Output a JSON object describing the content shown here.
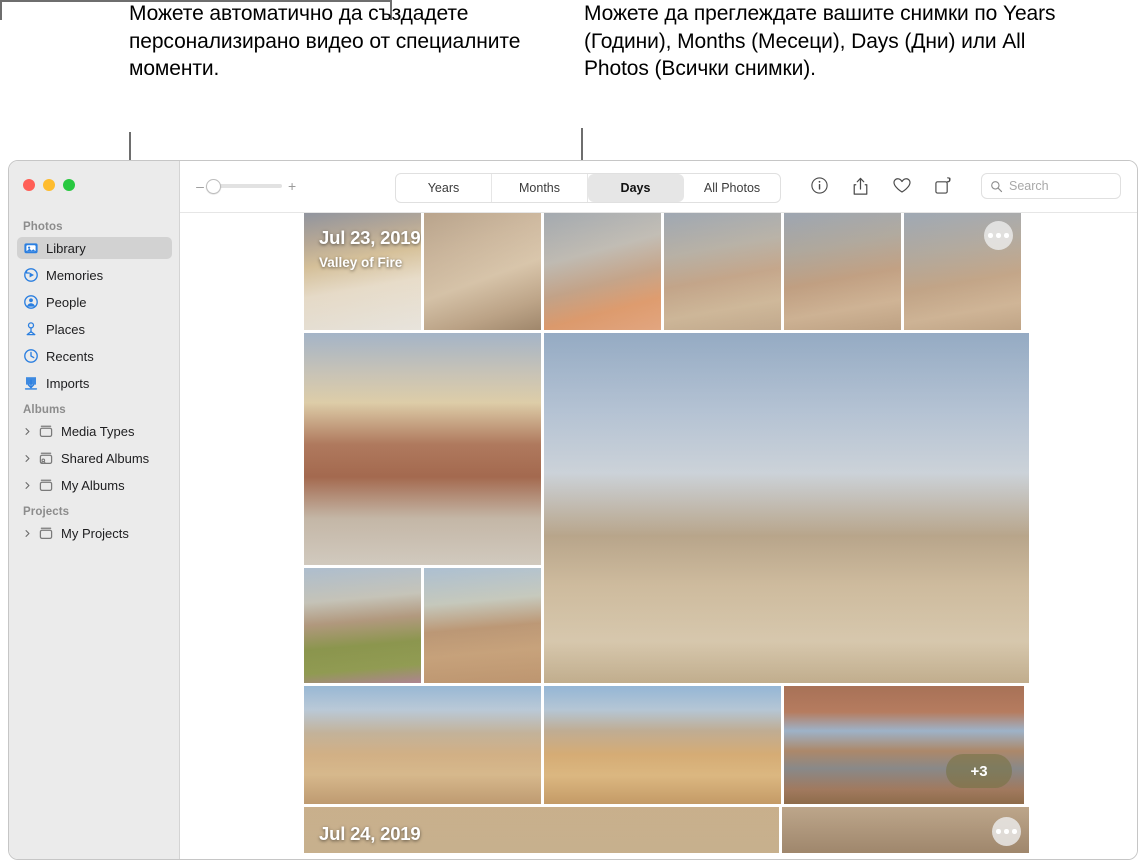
{
  "callouts": {
    "left": "Можете автоматично да създадете персонализирано видео от специалните моменти.",
    "right": "Можете да преглеждате вашите снимки по Years (Години), Months (Месеци), Days (Дни) или All Photos (Всички снимки)."
  },
  "window": {
    "traffic_lights": [
      "close",
      "minimize",
      "zoom"
    ],
    "colors": {
      "close": "#ff5f57",
      "minimize": "#febc2e",
      "zoom": "#28c840",
      "sidebar_bg": "#ebebeb",
      "selected_row": "#d2d2d2",
      "icon_blue": "#2b7fe0",
      "content_bg": "#ffffff"
    }
  },
  "sidebar": {
    "groups": [
      {
        "header": "Photos",
        "items": [
          {
            "label": "Library",
            "icon": "library-icon",
            "selected": true,
            "expandable": false
          },
          {
            "label": "Memories",
            "icon": "memories-icon",
            "selected": false,
            "expandable": false
          },
          {
            "label": "People",
            "icon": "people-icon",
            "selected": false,
            "expandable": false
          },
          {
            "label": "Places",
            "icon": "places-icon",
            "selected": false,
            "expandable": false
          },
          {
            "label": "Recents",
            "icon": "recents-icon",
            "selected": false,
            "expandable": false
          },
          {
            "label": "Imports",
            "icon": "imports-icon",
            "selected": false,
            "expandable": false
          }
        ]
      },
      {
        "header": "Albums",
        "items": [
          {
            "label": "Media Types",
            "icon": "album-icon",
            "selected": false,
            "expandable": true
          },
          {
            "label": "Shared Albums",
            "icon": "shared-album-icon",
            "selected": false,
            "expandable": true
          },
          {
            "label": "My Albums",
            "icon": "album-icon",
            "selected": false,
            "expandable": true
          }
        ]
      },
      {
        "header": "Projects",
        "items": [
          {
            "label": "My Projects",
            "icon": "album-icon",
            "selected": false,
            "expandable": true
          }
        ]
      }
    ]
  },
  "toolbar": {
    "zoom_out_label": "–",
    "zoom_in_label": "+",
    "zoom_value": 0,
    "segments": [
      {
        "label": "Years",
        "active": false
      },
      {
        "label": "Months",
        "active": false
      },
      {
        "label": "Days",
        "active": true
      },
      {
        "label": "All Photos",
        "active": false
      }
    ],
    "icons": [
      {
        "name": "info-icon"
      },
      {
        "name": "share-icon"
      },
      {
        "name": "favorite-heart-icon"
      },
      {
        "name": "rotate-icon"
      }
    ],
    "search": {
      "placeholder": "Search",
      "value": ""
    }
  },
  "content": {
    "days": [
      {
        "date": "Jul 23, 2019",
        "location": "Valley of Fire",
        "more_button": "more-options-icon",
        "overflow_badge": "+3"
      },
      {
        "date": "Jul 24, 2019",
        "location": "",
        "more_button": "more-options-icon",
        "overflow_badge": ""
      }
    ]
  }
}
